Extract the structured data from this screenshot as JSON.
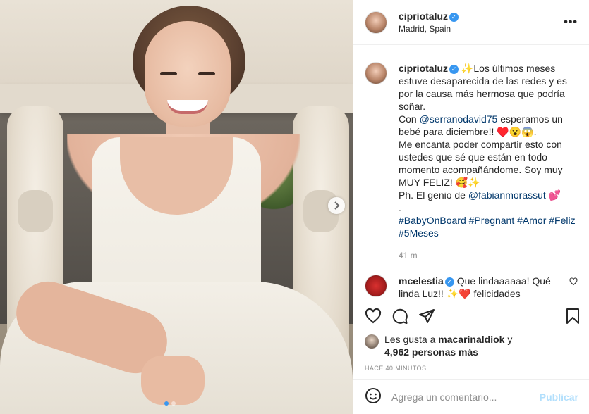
{
  "post": {
    "username": "cipriotaluz",
    "verified_glyph": "✓",
    "location": "Madrid, Spain",
    "more": "•••",
    "photo_indicator": {
      "count": 2,
      "active": 0
    }
  },
  "caption": {
    "username": "cipriotaluz",
    "lines": [
      "✨Los últimos meses estuve desaparecida de las redes y es por la causa más hermosa que podría soñar.",
      "Con ",
      "@serranodavid75",
      " esperamos un bebé para diciembre!! ♥️😮😱.",
      "Me encanta poder compartir esto con ustedes que sé que están en todo momento acompañándome. Soy muy MUY FELIZ! 🥰✨",
      "Ph. El genio de ",
      "@fabianmorassut",
      " 💕",
      ".",
      "#BabyOnBoard #Pregnant #Amor #Feliz #5Meses"
    ],
    "time": "41 m"
  },
  "comment": {
    "username": "mcelestia",
    "text": " Que lindaaaaaa! Qué linda Luz!! ✨❤️ felicidades"
  },
  "likes": {
    "prefix": "Les gusta a ",
    "user": "macarinaldiok",
    "suffix": " y",
    "others": "4,962 personas más"
  },
  "ago": "HACE 40 MINUTOS",
  "composer": {
    "placeholder": "Agrega un comentario...",
    "publish": "Publicar"
  },
  "icons": {
    "like": "heart-icon",
    "comment": "comment-icon",
    "share": "share-icon",
    "save": "bookmark-icon",
    "emoji": "emoji-icon",
    "next": "chevron-right-icon"
  },
  "colors": {
    "link": "#00376b",
    "verified": "#3897f0",
    "publish_disabled": "#b2dffc",
    "muted": "#8e8e8e"
  }
}
